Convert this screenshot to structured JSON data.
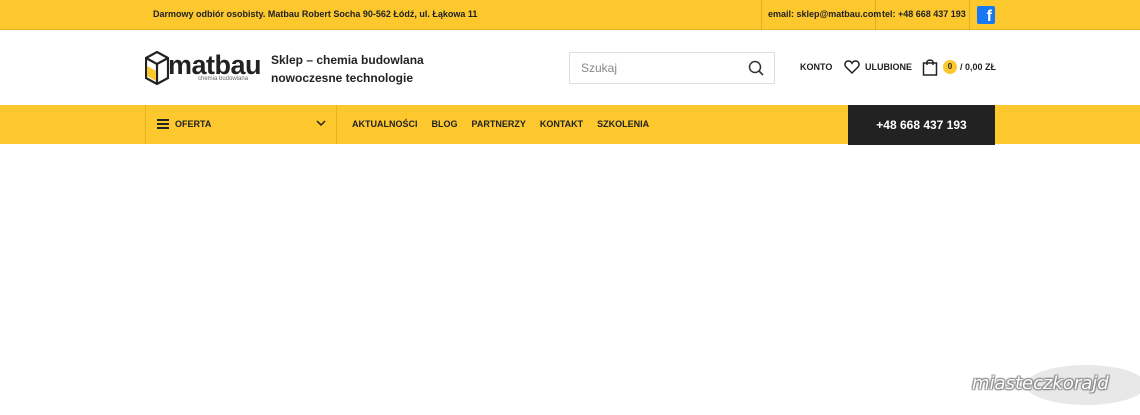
{
  "topbar": {
    "pickup": "Darmowy odbiór osobisty. Matbau Robert Socha 90-562 Łódź, ul. Łąkowa 11",
    "email": "email: sklep@matbau.com",
    "tel": "tel: +48 668 437 193",
    "facebook_icon": "facebook-icon"
  },
  "header": {
    "logo_word": "matbau",
    "logo_sub": "chemia budowlana",
    "tagline_line1": "Sklep – chemia budowlana",
    "tagline_line2": "nowoczesne technologie",
    "search_placeholder": "Szukaj",
    "konto": "KONTO",
    "ulubione": "ULUBIONE",
    "cart_count": "0",
    "cart_total": "/ 0,00 ZŁ"
  },
  "nav": {
    "oferta": "OFERTA",
    "items": [
      "AKTUALNOŚCI",
      "BLOG",
      "PARTNERZY",
      "KONTAKT",
      "SZKOLENIA"
    ],
    "phone": "+48 668 437 193"
  },
  "watermark": "miasteczkorajd",
  "colors": {
    "accent": "#fcc82e",
    "dark": "#222222"
  }
}
